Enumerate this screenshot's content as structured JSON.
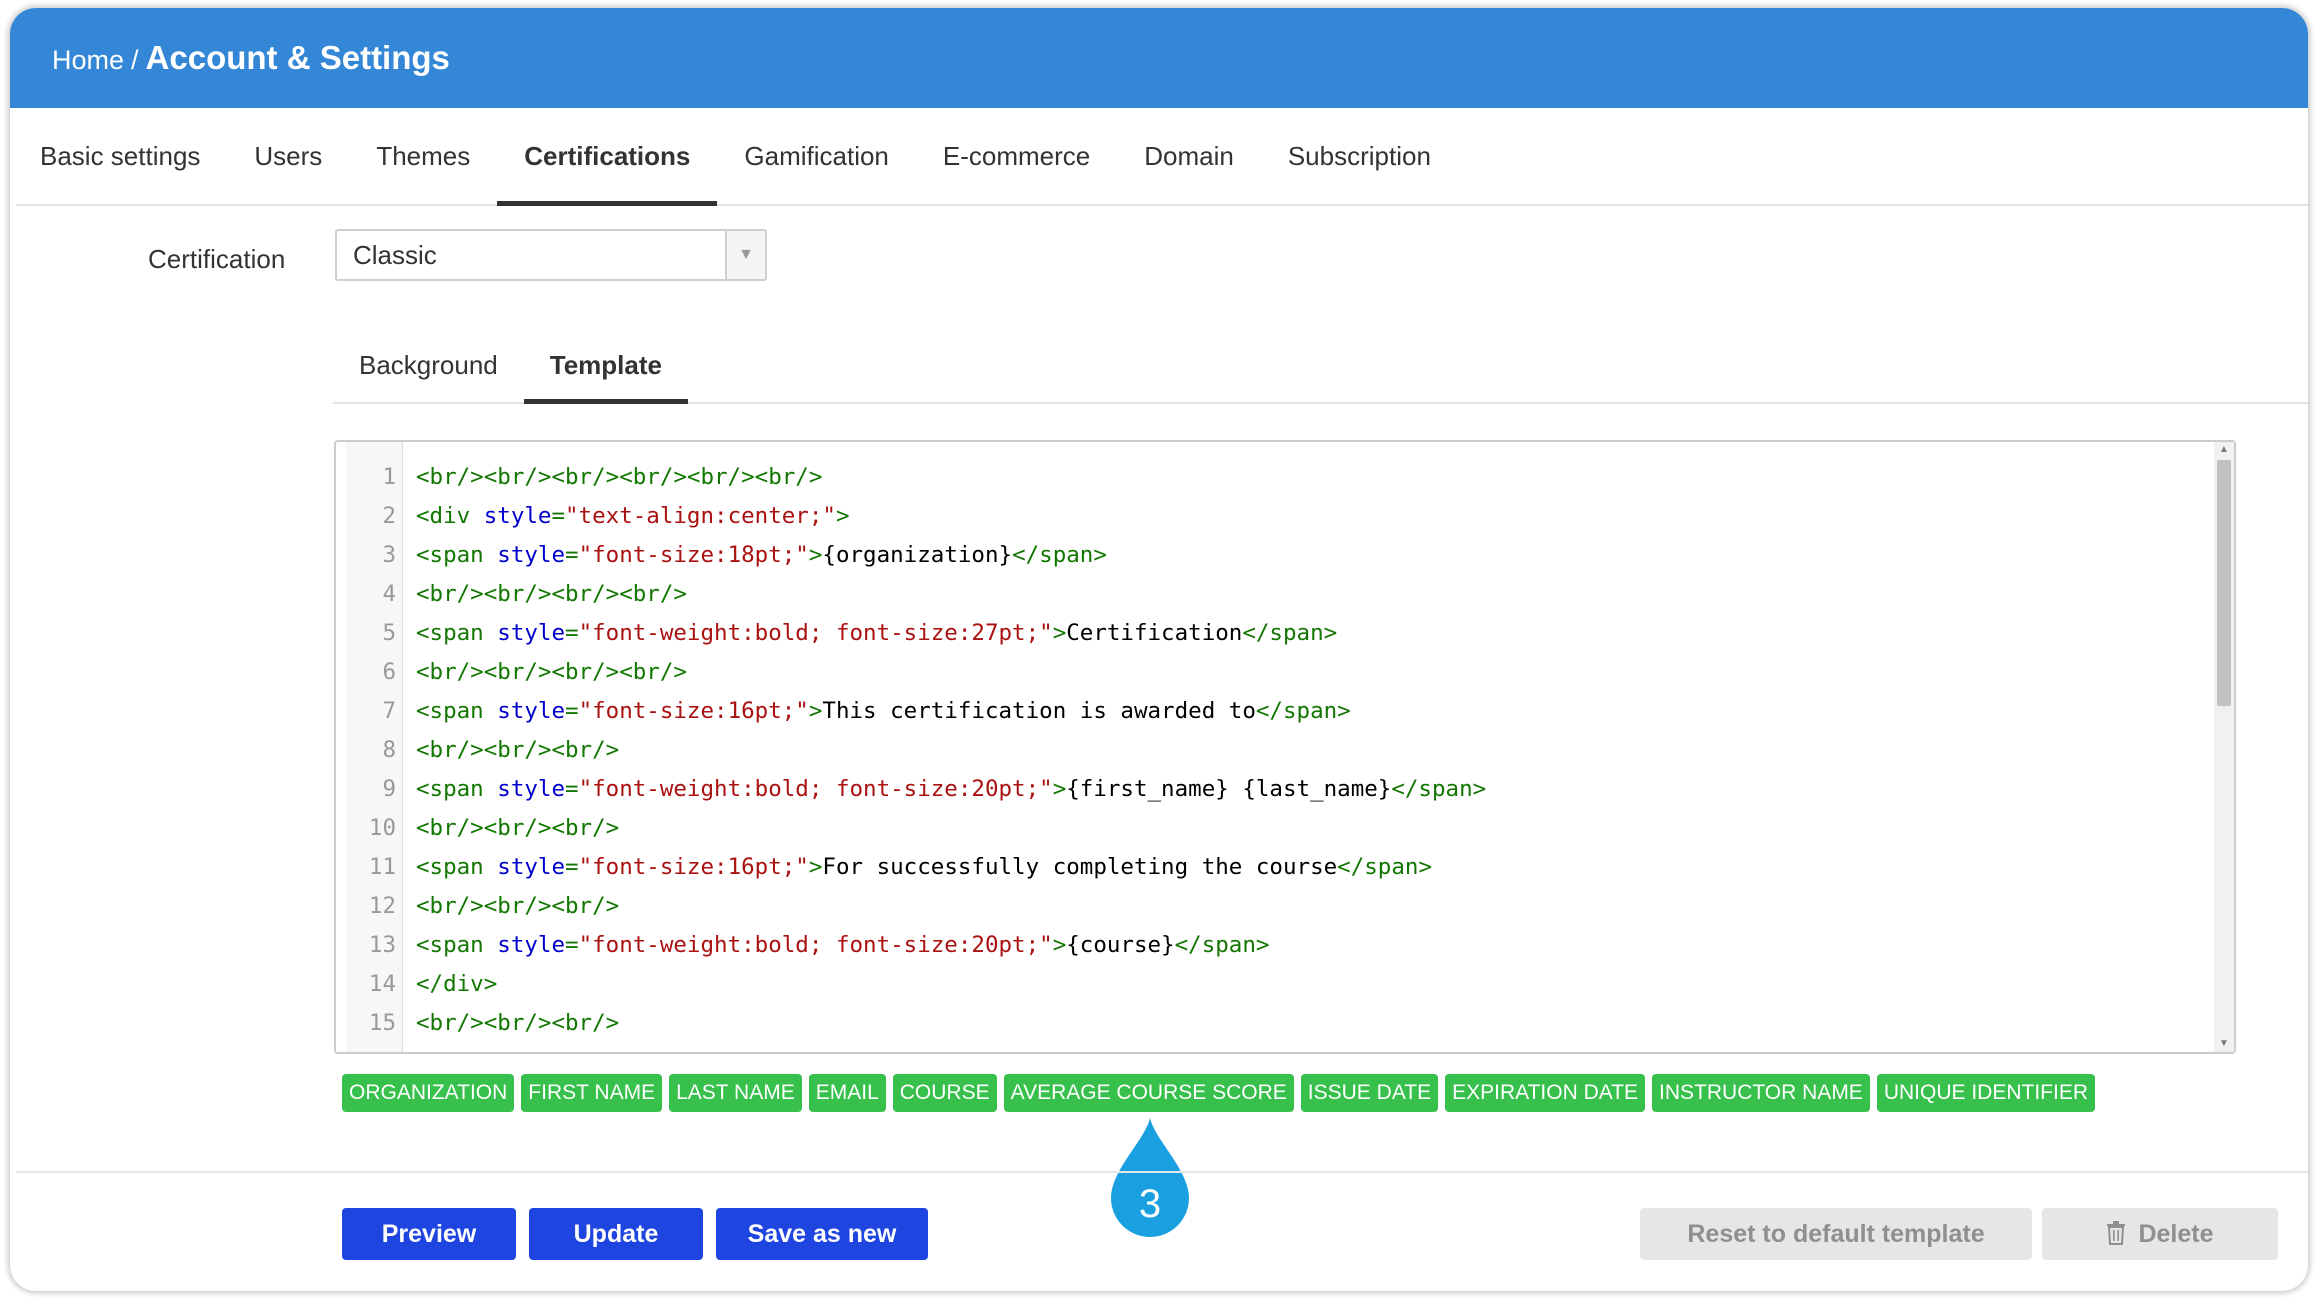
{
  "header": {
    "home": "Home",
    "separator": "/",
    "title": "Account & Settings"
  },
  "main_tabs": [
    {
      "label": "Basic settings"
    },
    {
      "label": "Users"
    },
    {
      "label": "Themes"
    },
    {
      "label": "Certifications",
      "active": true
    },
    {
      "label": "Gamification"
    },
    {
      "label": "E-commerce"
    },
    {
      "label": "Domain"
    },
    {
      "label": "Subscription"
    }
  ],
  "certification": {
    "label": "Certification",
    "selected": "Classic"
  },
  "sub_tabs": [
    {
      "label": "Background"
    },
    {
      "label": "Template",
      "active": true
    }
  ],
  "editor": {
    "lines": [
      {
        "n": "1",
        "tokens": [
          {
            "t": "tag",
            "v": "<br/><br/><br/><br/><br/><br/>"
          }
        ]
      },
      {
        "n": "2",
        "tokens": [
          {
            "t": "tag",
            "v": "<div "
          },
          {
            "t": "attr",
            "v": "style"
          },
          {
            "t": "tag",
            "v": "="
          },
          {
            "t": "str",
            "v": "\"text-align:center;\""
          },
          {
            "t": "tag",
            "v": ">"
          }
        ]
      },
      {
        "n": "3",
        "tokens": [
          {
            "t": "tag",
            "v": "<span "
          },
          {
            "t": "attr",
            "v": "style"
          },
          {
            "t": "tag",
            "v": "="
          },
          {
            "t": "str",
            "v": "\"font-size:18pt;\""
          },
          {
            "t": "tag",
            "v": ">"
          },
          {
            "t": "text",
            "v": "{organization}"
          },
          {
            "t": "tag",
            "v": "</span>"
          }
        ]
      },
      {
        "n": "4",
        "tokens": [
          {
            "t": "tag",
            "v": "<br/><br/><br/><br/>"
          }
        ]
      },
      {
        "n": "5",
        "tokens": [
          {
            "t": "tag",
            "v": "<span "
          },
          {
            "t": "attr",
            "v": "style"
          },
          {
            "t": "tag",
            "v": "="
          },
          {
            "t": "str",
            "v": "\"font-weight:bold; font-size:27pt;\""
          },
          {
            "t": "tag",
            "v": ">"
          },
          {
            "t": "text",
            "v": "Certification"
          },
          {
            "t": "tag",
            "v": "</span>"
          }
        ]
      },
      {
        "n": "6",
        "tokens": [
          {
            "t": "tag",
            "v": "<br/><br/><br/><br/>"
          }
        ]
      },
      {
        "n": "7",
        "tokens": [
          {
            "t": "tag",
            "v": "<span "
          },
          {
            "t": "attr",
            "v": "style"
          },
          {
            "t": "tag",
            "v": "="
          },
          {
            "t": "str",
            "v": "\"font-size:16pt;\""
          },
          {
            "t": "tag",
            "v": ">"
          },
          {
            "t": "text",
            "v": "This certification is awarded to"
          },
          {
            "t": "tag",
            "v": "</span>"
          }
        ]
      },
      {
        "n": "8",
        "tokens": [
          {
            "t": "tag",
            "v": "<br/><br/><br/>"
          }
        ]
      },
      {
        "n": "9",
        "tokens": [
          {
            "t": "tag",
            "v": "<span "
          },
          {
            "t": "attr",
            "v": "style"
          },
          {
            "t": "tag",
            "v": "="
          },
          {
            "t": "str",
            "v": "\"font-weight:bold; font-size:20pt;\""
          },
          {
            "t": "tag",
            "v": ">"
          },
          {
            "t": "text",
            "v": "{first_name} {last_name}"
          },
          {
            "t": "tag",
            "v": "</span>"
          }
        ]
      },
      {
        "n": "10",
        "tokens": [
          {
            "t": "tag",
            "v": "<br/><br/><br/>"
          }
        ]
      },
      {
        "n": "11",
        "tokens": [
          {
            "t": "tag",
            "v": "<span "
          },
          {
            "t": "attr",
            "v": "style"
          },
          {
            "t": "tag",
            "v": "="
          },
          {
            "t": "str",
            "v": "\"font-size:16pt;\""
          },
          {
            "t": "tag",
            "v": ">"
          },
          {
            "t": "text",
            "v": "For successfully completing the course"
          },
          {
            "t": "tag",
            "v": "</span>"
          }
        ]
      },
      {
        "n": "12",
        "tokens": [
          {
            "t": "tag",
            "v": "<br/><br/><br/>"
          }
        ]
      },
      {
        "n": "13",
        "tokens": [
          {
            "t": "tag",
            "v": "<span "
          },
          {
            "t": "attr",
            "v": "style"
          },
          {
            "t": "tag",
            "v": "="
          },
          {
            "t": "str",
            "v": "\"font-weight:bold; font-size:20pt;\""
          },
          {
            "t": "tag",
            "v": ">"
          },
          {
            "t": "text",
            "v": "{course}"
          },
          {
            "t": "tag",
            "v": "</span>"
          }
        ]
      },
      {
        "n": "14",
        "tokens": [
          {
            "t": "tag",
            "v": "</div>"
          }
        ]
      },
      {
        "n": "15",
        "tokens": [
          {
            "t": "tag",
            "v": "<br/><br/><br/>"
          }
        ]
      }
    ]
  },
  "placeholders": [
    "ORGANIZATION",
    "FIRST NAME",
    "LAST NAME",
    "EMAIL",
    "COURSE",
    "AVERAGE COURSE SCORE",
    "ISSUE DATE",
    "EXPIRATION DATE",
    "INSTRUCTOR NAME",
    "UNIQUE IDENTIFIER"
  ],
  "callout": {
    "number": "3",
    "color": "#1a9fe0"
  },
  "buttons": {
    "preview": "Preview",
    "update": "Update",
    "save_as_new": "Save as new",
    "reset": "Reset to default template",
    "delete": "Delete"
  },
  "colors": {
    "header_bg": "#3487d6",
    "primary_button": "#1e45e0",
    "tag_green": "#37c04b",
    "disabled_button": "#e6e6e6"
  }
}
